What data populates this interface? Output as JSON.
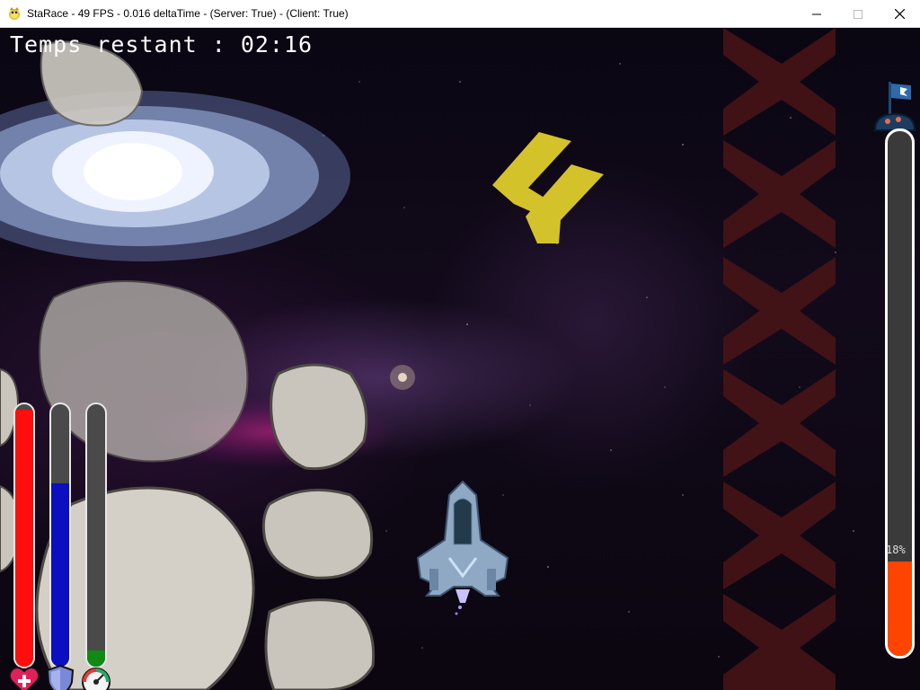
{
  "window": {
    "title": "StaRace - 49 FPS - 0.016 deltaTime - (Server: True) - (Client: True)",
    "controls": [
      "minimize",
      "maximize",
      "close"
    ]
  },
  "hud": {
    "timer_text": "Temps restant : 02:16",
    "gauges": [
      {
        "id": "health",
        "icon": "heart-plus-icon",
        "fill": 0.98,
        "color": "#ff0e0e"
      },
      {
        "id": "shield",
        "icon": "shield-icon",
        "fill": 0.7,
        "color": "#0b0fbf"
      },
      {
        "id": "boost",
        "icon": "speedometer-icon",
        "fill": 0.06,
        "color": "#0f8a14"
      }
    ],
    "race_progress": {
      "label": "18%",
      "value": 0.18,
      "color": "#ff4400",
      "icon": "finish-flag-icon"
    }
  },
  "scene": {
    "player": "spaceship",
    "direction_marker": "yellow-chevrons-icon",
    "track_edge": "red-x-markers"
  }
}
